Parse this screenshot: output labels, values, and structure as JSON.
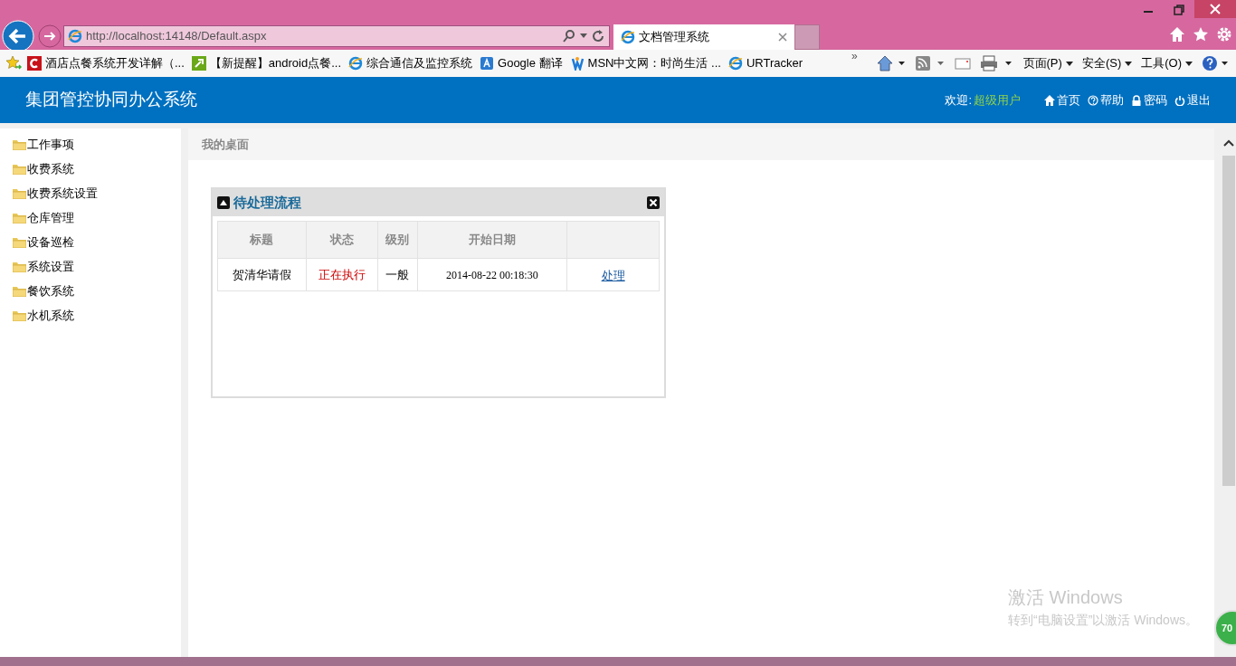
{
  "browser": {
    "address": "http://localhost:14148/Default.aspx",
    "tabs": [
      {
        "title": "文档管理系统",
        "selected": true
      }
    ],
    "favorites": [
      {
        "label": "酒店点餐系统开发详解（..."
      },
      {
        "label": "【新提醒】android点餐..."
      },
      {
        "label": "综合通信及监控系统"
      },
      {
        "label": "Google 翻译"
      },
      {
        "label": "MSN中文网：时尚生活 ..."
      },
      {
        "label": "URTracker"
      }
    ],
    "overflow": "»",
    "commands": [
      "页面(P)",
      "安全(S)",
      "工具(O)"
    ]
  },
  "header": {
    "title": "集团管控协同办公系统",
    "welcome_label": "欢迎:",
    "user": "超级用户",
    "links": [
      {
        "kind": "home",
        "label": "首页"
      },
      {
        "kind": "help",
        "label": "帮助"
      },
      {
        "kind": "lock",
        "label": "密码"
      },
      {
        "kind": "power",
        "label": "退出"
      }
    ]
  },
  "sidebar": {
    "items": [
      {
        "label": "工作事项"
      },
      {
        "label": "收费系统"
      },
      {
        "label": "收费系统设置"
      },
      {
        "label": "仓库管理"
      },
      {
        "label": "设备巡检"
      },
      {
        "label": "系统设置"
      },
      {
        "label": "餐饮系统"
      },
      {
        "label": "水机系统"
      }
    ]
  },
  "breadcrumb": "我的桌面",
  "panel": {
    "title": "待处理流程",
    "expanded": true,
    "table": {
      "columns": [
        "标题",
        "状态",
        "级别",
        "开始日期",
        ""
      ],
      "rows": [
        {
          "title": "贺清华请假",
          "status": "正在执行",
          "level": "一般",
          "start": "2014-08-22 00:18:30",
          "action": "处理"
        }
      ]
    }
  },
  "activation": {
    "title": "激活 Windows",
    "text": "转到“电脑设置”以激活 Windows。"
  },
  "badge": "70"
}
